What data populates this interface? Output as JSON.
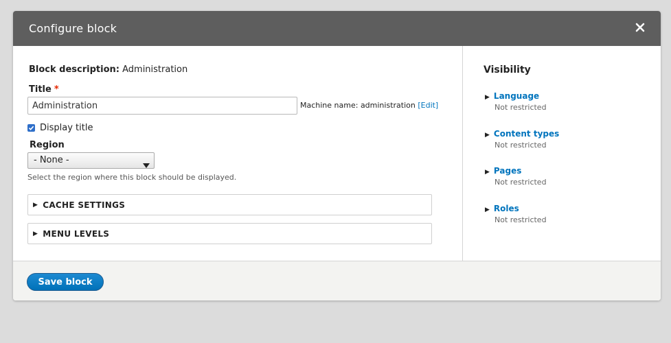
{
  "dialog": {
    "title": "Configure block",
    "close_icon": "close-icon"
  },
  "form": {
    "description_label": "Block description:",
    "description_value": "Administration",
    "title_label": "Title",
    "required_marker": "*",
    "title_value": "Administration",
    "machine_name_text": "Machine name: administration",
    "machine_edit_link": "[Edit]",
    "display_title_label": "Display title",
    "display_title_checked": true,
    "region_label": "Region",
    "region_selected": "- None -",
    "region_help": "Select the region where this block should be displayed.",
    "sections": [
      {
        "label": "CACHE SETTINGS"
      },
      {
        "label": "MENU LEVELS"
      }
    ]
  },
  "visibility": {
    "title": "Visibility",
    "items": [
      {
        "label": "Language",
        "status": "Not restricted"
      },
      {
        "label": "Content types",
        "status": "Not restricted"
      },
      {
        "label": "Pages",
        "status": "Not restricted"
      },
      {
        "label": "Roles",
        "status": "Not restricted"
      }
    ]
  },
  "footer": {
    "save_label": "Save block"
  },
  "colors": {
    "titlebar": "#5e5e5e",
    "link": "#0074bd",
    "required": "#e62600",
    "button": "#0071b8",
    "page_bg": "#dcdcdc"
  }
}
